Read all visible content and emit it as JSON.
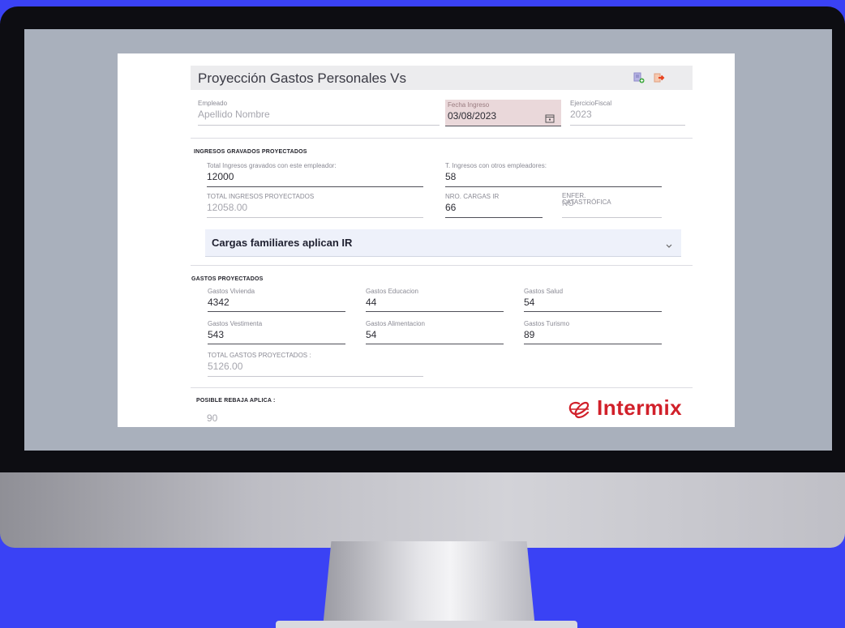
{
  "app": {
    "title": "Proyección Gastos Personales Vs",
    "icons": {
      "add": "add-document-icon",
      "exit": "exit-icon",
      "calendar": "calendar-icon",
      "chevron": "chevron-down-icon"
    }
  },
  "header_fields": {
    "empleado": {
      "label": "Empleado",
      "placeholder": "Apellido Nombre"
    },
    "fecha_ingreso": {
      "label": "Fecha Ingreso",
      "value": "03/08/2023"
    },
    "ejercicio_fiscal": {
      "label": "EjercicioFiscal",
      "value": "2023"
    }
  },
  "ingresos": {
    "section_title": "INGRESOS GRAVADOS PROYECTADOS",
    "total_con_empleador": {
      "label": "Total Ingresos gravados con este empleador:",
      "value": "12000"
    },
    "otros_empleadores": {
      "label": "T. Ingresos con otros empleadores:",
      "value": "58"
    },
    "total_proyectados": {
      "label": "TOTAL INGRESOS PROYECTADOS",
      "value": "12058.00"
    },
    "nro_cargas": {
      "label": "NRO. CARGAS IR",
      "value": "66"
    },
    "enfer_catastrofica": {
      "label": "ENFER. CATASTRÓFICA",
      "value": "NO"
    }
  },
  "accordion": {
    "label": "Cargas familiares aplican IR"
  },
  "gastos": {
    "section_title": "GASTOS PROYECTADOS",
    "vivienda": {
      "label": "Gastos Vivienda",
      "value": "4342"
    },
    "educacion": {
      "label": "Gastos Educacion",
      "value": "44"
    },
    "salud": {
      "label": "Gastos Salud",
      "value": "54"
    },
    "vestimenta": {
      "label": "Gastos Vestimenta",
      "value": "543"
    },
    "alimentacion": {
      "label": "Gastos Alimentacion",
      "value": "54"
    },
    "turismo": {
      "label": "Gastos Turismo",
      "value": "89"
    },
    "total": {
      "label": "TOTAL GASTOS PROYECTADOS :",
      "value": "5126.00"
    }
  },
  "rebaja": {
    "section_title": "POSIBLE REBAJA APLICA :",
    "value": "90"
  },
  "brand": {
    "name": "Intermix",
    "color": "#d1202a"
  }
}
